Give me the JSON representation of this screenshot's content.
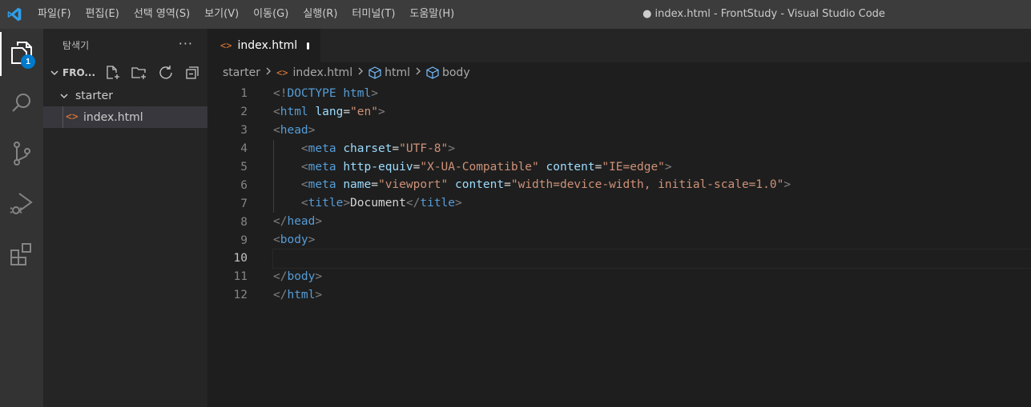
{
  "titlebar": {
    "menus": [
      "파일(F)",
      "편집(E)",
      "선택 영역(S)",
      "보기(V)",
      "이동(G)",
      "실행(R)",
      "터미널(T)",
      "도움말(H)"
    ],
    "window_title": "● index.html - FrontStudy - Visual Studio Code"
  },
  "activity_bar": {
    "icons": [
      "explorer-icon",
      "search-icon",
      "source-control-icon",
      "run-debug-icon",
      "extensions-icon"
    ],
    "explorer_badge": "1"
  },
  "sidebar": {
    "header": "탐색기",
    "more_label": "···",
    "section_name": "FRO...",
    "action_icons": [
      "new-file-icon",
      "new-folder-icon",
      "refresh-icon",
      "collapse-all-icon"
    ],
    "tree": [
      {
        "type": "folder",
        "label": "starter",
        "expanded": true
      },
      {
        "type": "file",
        "label": "index.html",
        "icon": "<>",
        "selected": true
      }
    ]
  },
  "editor": {
    "tab": {
      "label": "index.html",
      "icon": "<>",
      "dirty": true
    },
    "breadcrumbs": [
      "starter",
      "index.html",
      "html",
      "body"
    ],
    "current_line": 10,
    "lines": [
      {
        "n": "1",
        "tokens": [
          [
            "punct",
            "<!"
          ],
          [
            "doctype",
            "DOCTYPE"
          ],
          [
            "text",
            " "
          ],
          [
            "tag",
            "html"
          ],
          [
            "punct",
            ">"
          ]
        ]
      },
      {
        "n": "2",
        "tokens": [
          [
            "punct",
            "<"
          ],
          [
            "tag",
            "html"
          ],
          [
            "text",
            " "
          ],
          [
            "attr",
            "lang"
          ],
          [
            "text",
            "="
          ],
          [
            "str",
            "\"en\""
          ],
          [
            "punct",
            ">"
          ]
        ]
      },
      {
        "n": "3",
        "tokens": [
          [
            "punct",
            "<"
          ],
          [
            "tag",
            "head"
          ],
          [
            "punct",
            ">"
          ]
        ]
      },
      {
        "n": "4",
        "indent": true,
        "tokens": [
          [
            "text",
            "    "
          ],
          [
            "punct",
            "<"
          ],
          [
            "tag",
            "meta"
          ],
          [
            "text",
            " "
          ],
          [
            "attr",
            "charset"
          ],
          [
            "text",
            "="
          ],
          [
            "str",
            "\"UTF-8\""
          ],
          [
            "punct",
            ">"
          ]
        ]
      },
      {
        "n": "5",
        "indent": true,
        "tokens": [
          [
            "text",
            "    "
          ],
          [
            "punct",
            "<"
          ],
          [
            "tag",
            "meta"
          ],
          [
            "text",
            " "
          ],
          [
            "attr",
            "http-equiv"
          ],
          [
            "text",
            "="
          ],
          [
            "str",
            "\"X-UA-Compatible\""
          ],
          [
            "text",
            " "
          ],
          [
            "attr",
            "content"
          ],
          [
            "text",
            "="
          ],
          [
            "str",
            "\"IE=edge\""
          ],
          [
            "punct",
            ">"
          ]
        ]
      },
      {
        "n": "6",
        "indent": true,
        "tokens": [
          [
            "text",
            "    "
          ],
          [
            "punct",
            "<"
          ],
          [
            "tag",
            "meta"
          ],
          [
            "text",
            " "
          ],
          [
            "attr",
            "name"
          ],
          [
            "text",
            "="
          ],
          [
            "str",
            "\"viewport\""
          ],
          [
            "text",
            " "
          ],
          [
            "attr",
            "content"
          ],
          [
            "text",
            "="
          ],
          [
            "str",
            "\"width=device-width, initial-scale=1.0\""
          ],
          [
            "punct",
            ">"
          ]
        ]
      },
      {
        "n": "7",
        "indent": true,
        "tokens": [
          [
            "text",
            "    "
          ],
          [
            "punct",
            "<"
          ],
          [
            "tag",
            "title"
          ],
          [
            "punct",
            ">"
          ],
          [
            "text",
            "Document"
          ],
          [
            "punct",
            "</"
          ],
          [
            "tag",
            "title"
          ],
          [
            "punct",
            ">"
          ]
        ]
      },
      {
        "n": "8",
        "tokens": [
          [
            "punct",
            "</"
          ],
          [
            "tag",
            "head"
          ],
          [
            "punct",
            ">"
          ]
        ]
      },
      {
        "n": "9",
        "tokens": [
          [
            "punct",
            "<"
          ],
          [
            "tag",
            "body"
          ],
          [
            "punct",
            ">"
          ]
        ]
      },
      {
        "n": "10",
        "tokens": []
      },
      {
        "n": "11",
        "tokens": [
          [
            "punct",
            "</"
          ],
          [
            "tag",
            "body"
          ],
          [
            "punct",
            ">"
          ]
        ]
      },
      {
        "n": "12",
        "tokens": [
          [
            "punct",
            "</"
          ],
          [
            "tag",
            "html"
          ],
          [
            "punct",
            ">"
          ]
        ]
      }
    ]
  },
  "colors": {
    "accent": "#007acc",
    "tag": "#569cd6",
    "attr": "#9cdcfe",
    "string": "#ce9178",
    "punct": "#808080",
    "html_icon": "#e37933"
  }
}
